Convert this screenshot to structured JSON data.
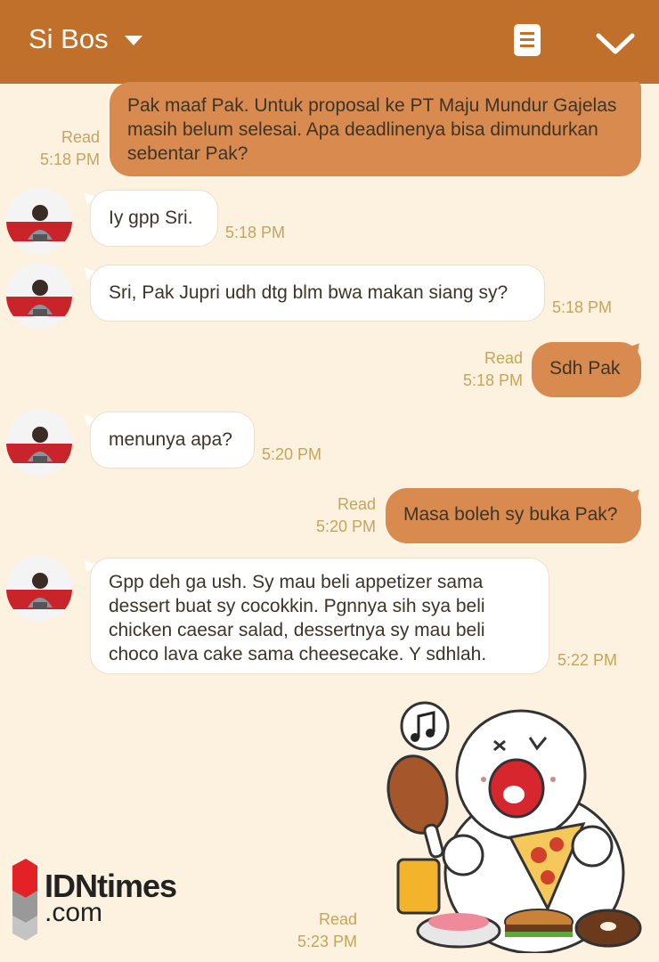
{
  "header": {
    "title": "Si Bos",
    "notes_icon": "notes-icon",
    "collapse_icon": "chevron-down-icon"
  },
  "colors": {
    "header": "#c0702a",
    "background": "#fdf2e0",
    "outgoing_bubble": "#d98a4f",
    "incoming_bubble": "#ffffff",
    "meta": "#c6a45a"
  },
  "messages": [
    {
      "dir": "out",
      "text": "Pak maaf Pak. Untuk proposal ke PT Maju Mundur Gajelas masih belum selesai. Apa deadlinenya bisa dimundurkan sebentar Pak?",
      "status": "Read",
      "time": "5:18 PM"
    },
    {
      "dir": "in",
      "text": "Iy gpp Sri.",
      "time": "5:18 PM"
    },
    {
      "dir": "in",
      "text": "Sri, Pak Jupri udh dtg blm bwa makan siang sy?",
      "time": "5:18 PM"
    },
    {
      "dir": "out",
      "text": "Sdh Pak",
      "status": "Read",
      "time": "5:18 PM"
    },
    {
      "dir": "in",
      "text": "menunya apa?",
      "time": "5:20 PM"
    },
    {
      "dir": "out",
      "text": "Masa boleh sy buka Pak?",
      "status": "Read",
      "time": "5:20 PM"
    },
    {
      "dir": "in",
      "text": "Gpp deh ga ush. Sy mau beli appetizer sama dessert buat sy cocokkin. Pgnnya sih sya beli chicken caesar salad, dessertnya sy mau beli choco lava cake sama cheesecake. Y sdhlah.",
      "time": "5:22 PM"
    },
    {
      "dir": "out",
      "type": "sticker",
      "sticker": "eating-character-sticker",
      "status": "Read",
      "time": "5:23 PM"
    }
  ],
  "watermark": {
    "line1": "IDNtimes",
    "line2": ".com"
  }
}
